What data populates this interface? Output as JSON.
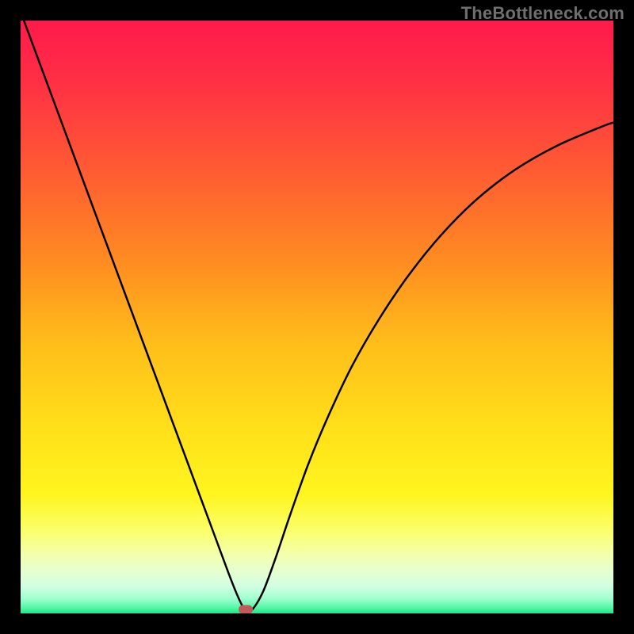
{
  "watermark": "TheBottleneck.com",
  "chart_data": {
    "type": "line",
    "title": "",
    "xlabel": "",
    "ylabel": "",
    "xlim": [
      0,
      100
    ],
    "ylim": [
      0,
      100
    ],
    "grid": false,
    "legend": false,
    "gradient_stops": [
      {
        "pos": 0.0,
        "color": "#ff1a4b"
      },
      {
        "pos": 0.1,
        "color": "#ff2f45"
      },
      {
        "pos": 0.25,
        "color": "#ff5a33"
      },
      {
        "pos": 0.4,
        "color": "#ff8a22"
      },
      {
        "pos": 0.55,
        "color": "#ffbf1a"
      },
      {
        "pos": 0.7,
        "color": "#ffe21a"
      },
      {
        "pos": 0.8,
        "color": "#fff51f"
      },
      {
        "pos": 0.86,
        "color": "#fbff6a"
      },
      {
        "pos": 0.9,
        "color": "#f4ffac"
      },
      {
        "pos": 0.93,
        "color": "#e6ffd1"
      },
      {
        "pos": 0.955,
        "color": "#d0ffe1"
      },
      {
        "pos": 0.975,
        "color": "#9fffcf"
      },
      {
        "pos": 0.99,
        "color": "#57f7a9"
      },
      {
        "pos": 1.0,
        "color": "#1de789"
      }
    ],
    "series": [
      {
        "name": "curve",
        "stroke": "#000000",
        "stroke_width": 2.5,
        "x": [
          0.0,
          3.0,
          6.0,
          9.0,
          12.0,
          15.0,
          18.0,
          21.0,
          24.0,
          27.0,
          30.0,
          33.0,
          35.0,
          36.5,
          37.5,
          38.2,
          39.3,
          41.0,
          43.0,
          45.5,
          48.5,
          52.0,
          56.0,
          60.5,
          65.5,
          71.0,
          77.0,
          83.5,
          90.5,
          98.0,
          100.0
        ],
        "y": [
          101.5,
          93.4,
          85.3,
          77.2,
          69.1,
          61.0,
          52.9,
          44.8,
          36.7,
          28.6,
          20.5,
          12.4,
          7.0,
          3.2,
          1.1,
          0.2,
          0.9,
          3.9,
          9.3,
          16.7,
          25.1,
          33.5,
          41.9,
          49.7,
          57.1,
          63.9,
          69.9,
          74.9,
          78.9,
          82.1,
          82.8
        ]
      }
    ],
    "marker": {
      "x": 38.0,
      "y": 0.7,
      "color": "#c35a5a"
    }
  }
}
